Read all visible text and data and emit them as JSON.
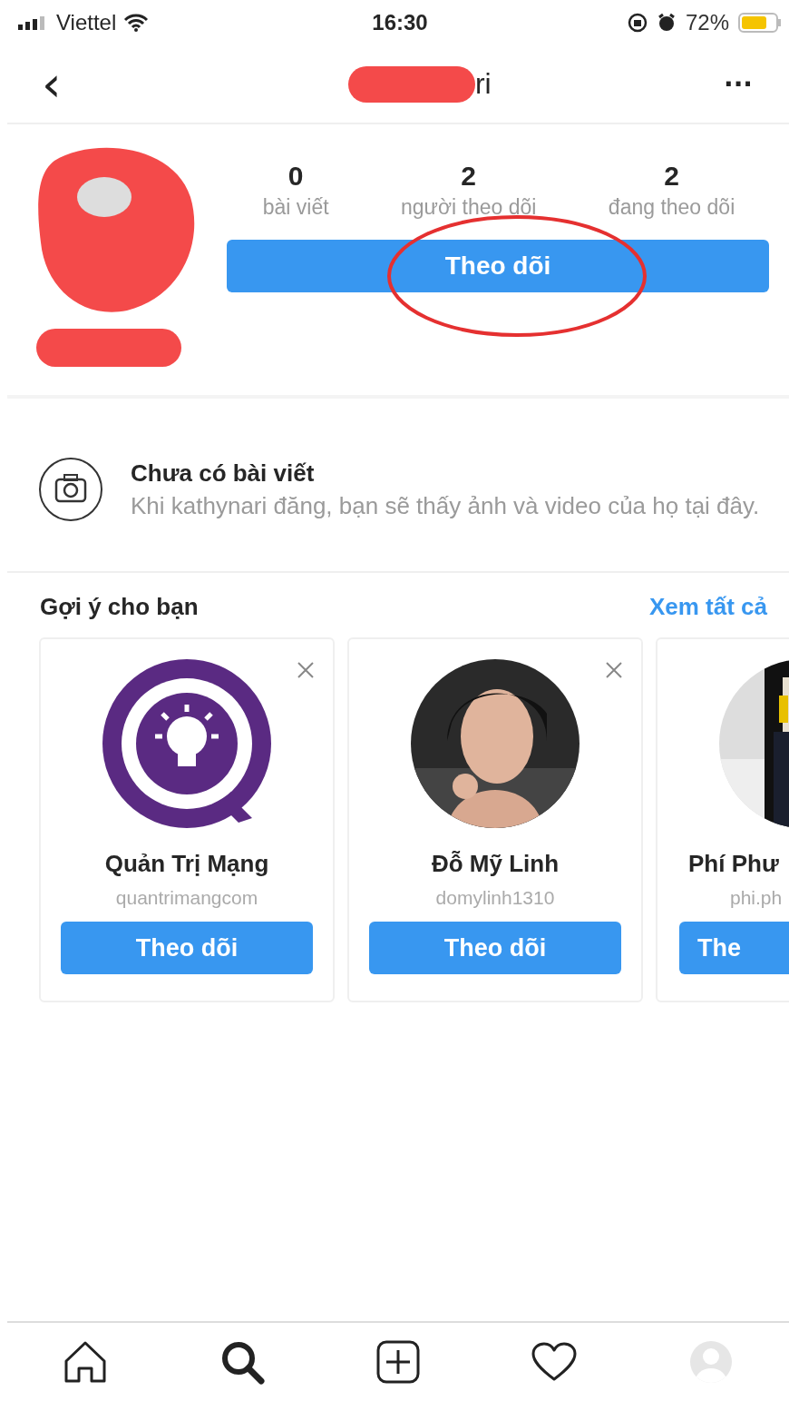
{
  "status_bar": {
    "carrier": "Viettel",
    "time": "16:30",
    "battery": "72%"
  },
  "nav": {
    "back_icon": "‹",
    "title": "ri",
    "more": "···"
  },
  "profile": {
    "stats": [
      {
        "value": "0",
        "label": "bài viết"
      },
      {
        "value": "2",
        "label": "người theo dõi"
      },
      {
        "value": "2",
        "label": "đang theo dõi"
      }
    ],
    "follow_button": "Theo dõi",
    "annotated": true
  },
  "empty_posts": {
    "title": "Chưa có bài viết",
    "text": "Khi kathynari đăng, bạn sẽ thấy ảnh và video của họ tại đây."
  },
  "suggestions": {
    "title": "Gợi ý cho bạn",
    "see_all": "Xem tất cả",
    "cards": [
      {
        "kind": "logo",
        "name": "Quản Trị Mạng",
        "username": "quantrimangcom",
        "button": "Theo dõi",
        "dismissable": true
      },
      {
        "kind": "picture",
        "name": "Đỗ Mỹ Linh",
        "username": "domylinh1310",
        "button": "Theo dõi",
        "dismissable": true
      },
      {
        "kind": "picture",
        "name": "Phí Phư",
        "username": "phi.ph",
        "button": "The",
        "dismissable": false
      }
    ]
  },
  "tab_bar": [
    {
      "kind": "home",
      "selected": false
    },
    {
      "kind": "search",
      "selected": true
    },
    {
      "kind": "add",
      "selected": false
    },
    {
      "kind": "heart",
      "selected": false
    },
    {
      "kind": "profile",
      "selected": false
    }
  ]
}
